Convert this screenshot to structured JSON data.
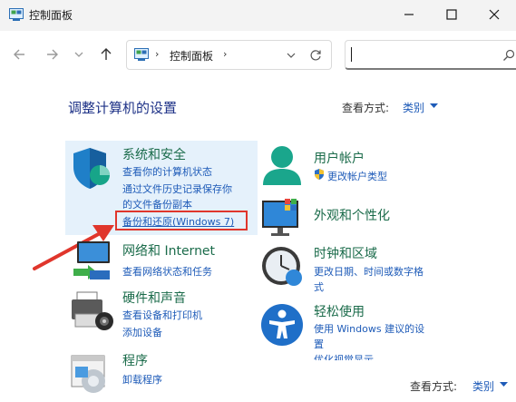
{
  "window": {
    "title": "控制面板",
    "minimize_icon": "minimize-icon",
    "maximize_icon": "maximize-icon",
    "close_icon": "close-icon"
  },
  "address": {
    "breadcrumb": "控制面板",
    "separator": "›",
    "search_placeholder": ""
  },
  "main": {
    "heading": "调整计算机的设置",
    "view_by_label": "查看方式:",
    "view_by_value": "类别"
  },
  "categories": {
    "security": {
      "title": "系统和安全",
      "links": [
        "查看你的计算机状态",
        "通过文件历史记录保存你",
        "的文件备份副本",
        "备份和还原(Windows 7)"
      ]
    },
    "network": {
      "title": "网络和 Internet",
      "links": [
        "查看网络状态和任务"
      ]
    },
    "hardware": {
      "title": "硬件和声音",
      "links": [
        "查看设备和打印机",
        "添加设备"
      ]
    },
    "programs": {
      "title": "程序",
      "links": [
        "卸载程序"
      ]
    },
    "users": {
      "title": "用户帐户",
      "links": [
        "更改帐户类型"
      ]
    },
    "appearance": {
      "title": "外观和个性化",
      "links": []
    },
    "clock": {
      "title": "时钟和区域",
      "links": [
        "更改日期、时间或数字格",
        "式"
      ]
    },
    "ease": {
      "title": "轻松使用",
      "links": [
        "使用 Windows 建议的设",
        "置",
        "优化视觉显示"
      ]
    }
  },
  "status": {
    "view_by_label": "查看方式:",
    "view_by_value": "类别"
  },
  "colors": {
    "title_text": "#1e3287",
    "category_title": "#1a6b4a",
    "link": "#1e5bb8",
    "highlight": "#e5f1fb",
    "annotation_red": "#e0362c"
  }
}
